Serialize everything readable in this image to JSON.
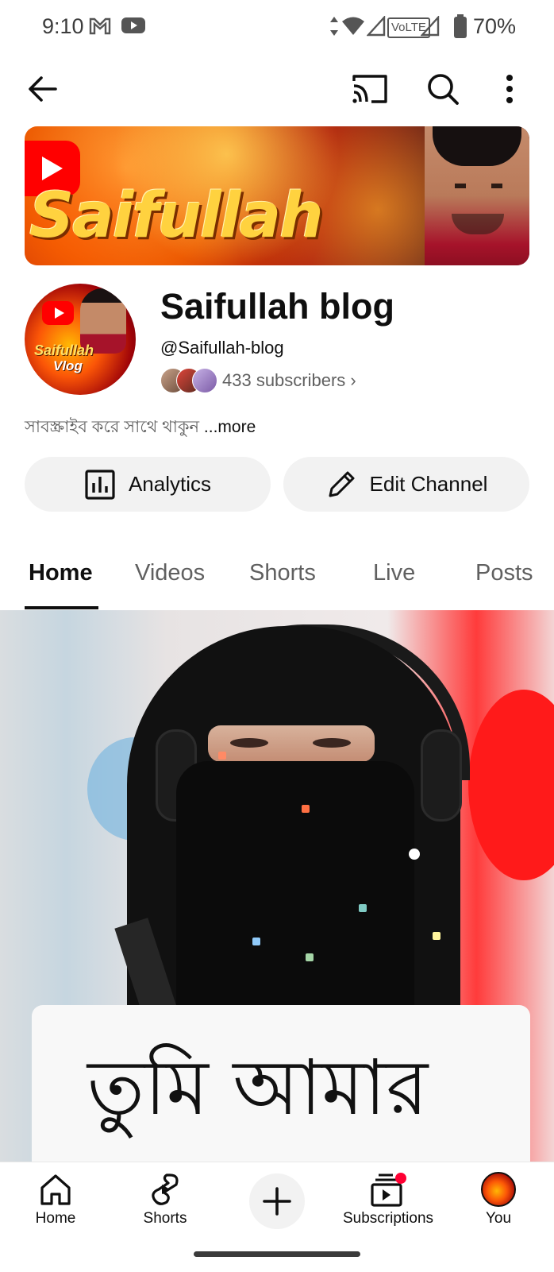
{
  "status_bar": {
    "time": "9:10",
    "battery": "70%",
    "network_label": "VoLTE"
  },
  "header": {
    "back_icon": "arrow-left-icon",
    "cast_icon": "cast-icon",
    "search_icon": "search-icon",
    "more_icon": "more-vertical-icon"
  },
  "banner": {
    "brand_text": "Saifullah"
  },
  "avatar": {
    "line1": "Saifullah",
    "line2": "Vlog"
  },
  "channel": {
    "name": "Saifullah blog",
    "handle": "@Saifullah-blog",
    "subscribers": "433 subscribers",
    "description": "সাবস্ক্রাইব করে সাথে থাকুন",
    "more_label": "...more"
  },
  "actions": {
    "analytics_label": "Analytics",
    "edit_label": "Edit Channel"
  },
  "tabs": [
    {
      "label": "Home",
      "active": true
    },
    {
      "label": "Videos"
    },
    {
      "label": "Shorts"
    },
    {
      "label": "Live"
    },
    {
      "label": "Posts"
    }
  ],
  "video": {
    "overlay_text": "তুমি আমার"
  },
  "bottom_nav": [
    {
      "label": "Home",
      "icon": "home-icon"
    },
    {
      "label": "Shorts",
      "icon": "shorts-icon"
    },
    {
      "label": "",
      "icon": "plus-icon"
    },
    {
      "label": "Subscriptions",
      "icon": "subscriptions-icon",
      "badge_color": "#ff0033"
    },
    {
      "label": "You",
      "icon": "avatar"
    }
  ]
}
